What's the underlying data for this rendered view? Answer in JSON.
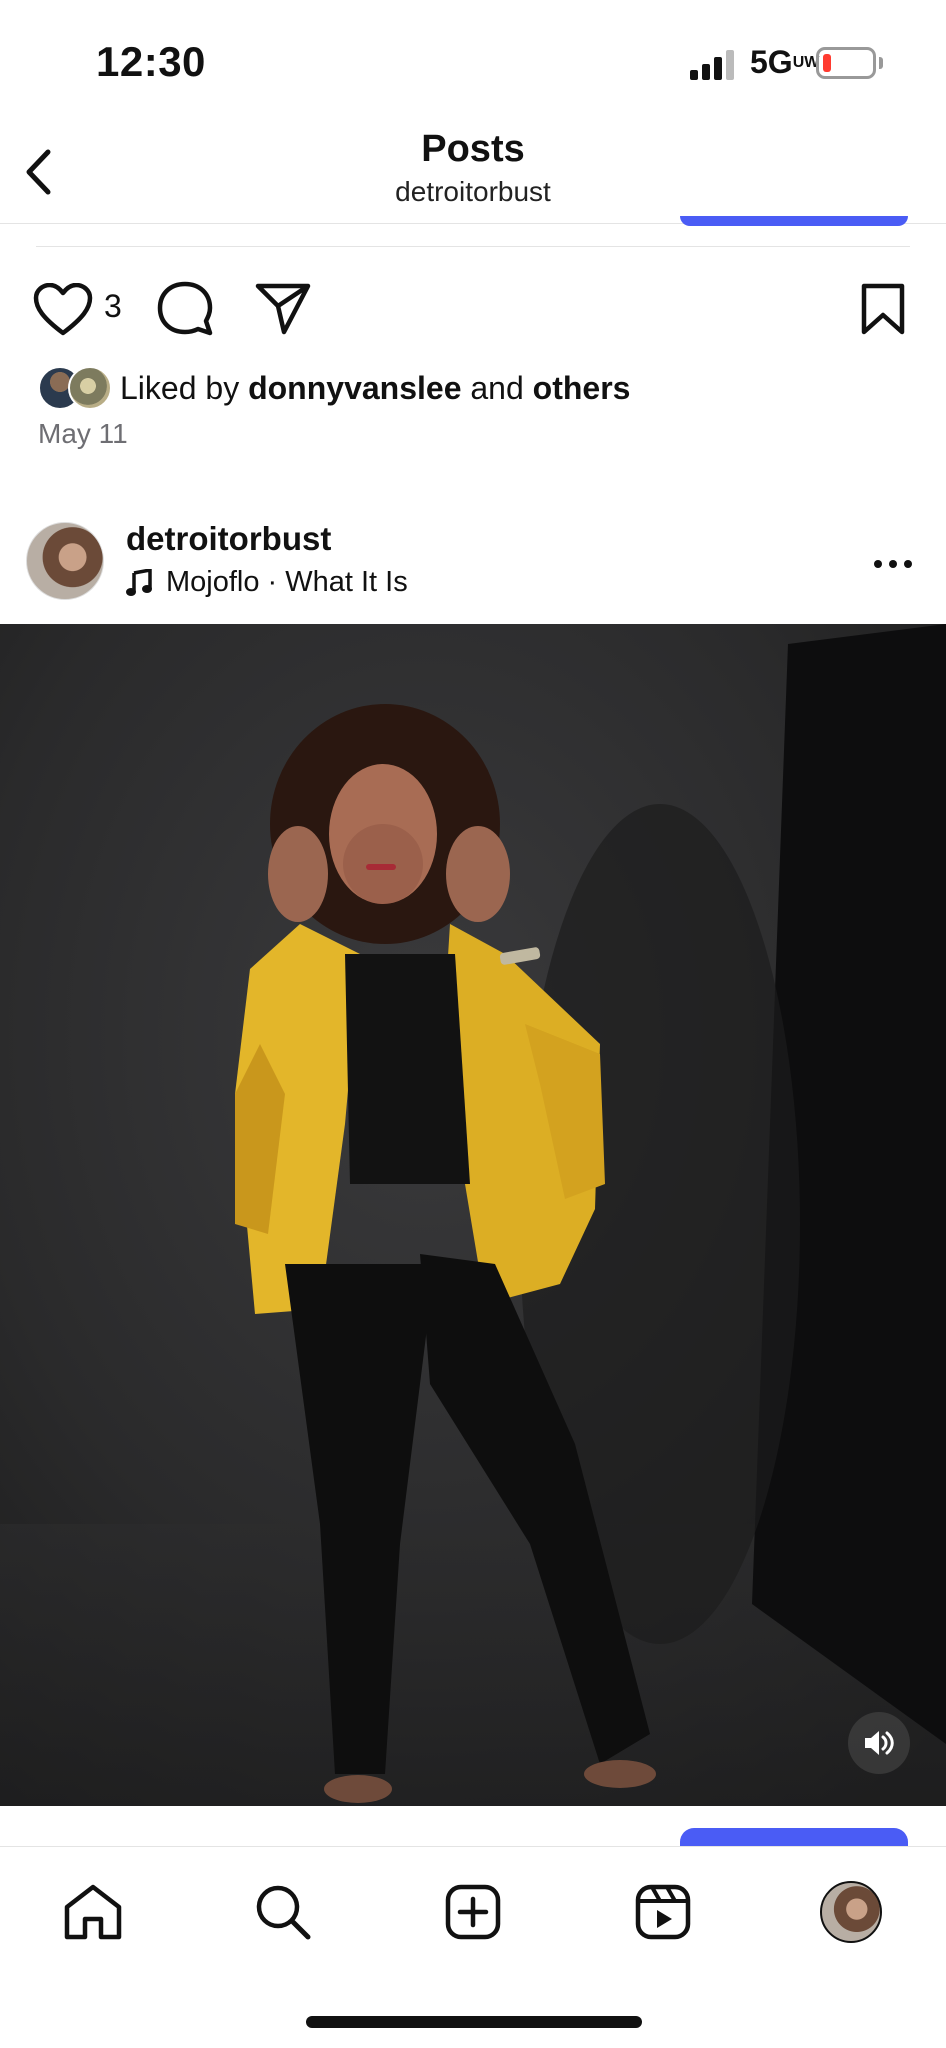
{
  "status_bar": {
    "time": "12:30",
    "network": "5G",
    "network_superscript": "UW",
    "battery_color": "#ff3b30"
  },
  "nav": {
    "title": "Posts",
    "subtitle": "detroitorbust",
    "back_icon": "chevron-left-icon"
  },
  "prev_post": {
    "like_icon": "heart-icon",
    "like_count": "3",
    "comment_icon": "comment-icon",
    "share_icon": "paper-plane-icon",
    "save_icon": "bookmark-icon",
    "likes_prefix": "Liked by ",
    "likes_user": "donnyvanslee",
    "likes_and": " and ",
    "likes_others": "others",
    "date": "May 11"
  },
  "post": {
    "username": "detroitorbust",
    "music_icon": "music-note-icon",
    "music": "Mojoflo · What It Is",
    "more_icon": "more-horizontal-icon",
    "mute_icon": "speaker-icon"
  },
  "tab_bar": {
    "items": [
      "home-icon",
      "search-icon",
      "create-icon",
      "reels-icon",
      "profile-avatar"
    ]
  },
  "colors": {
    "accent_blue": "#4a5cf5",
    "jacket_yellow": "#e8bb2a",
    "backdrop": "#2c2c2e"
  }
}
